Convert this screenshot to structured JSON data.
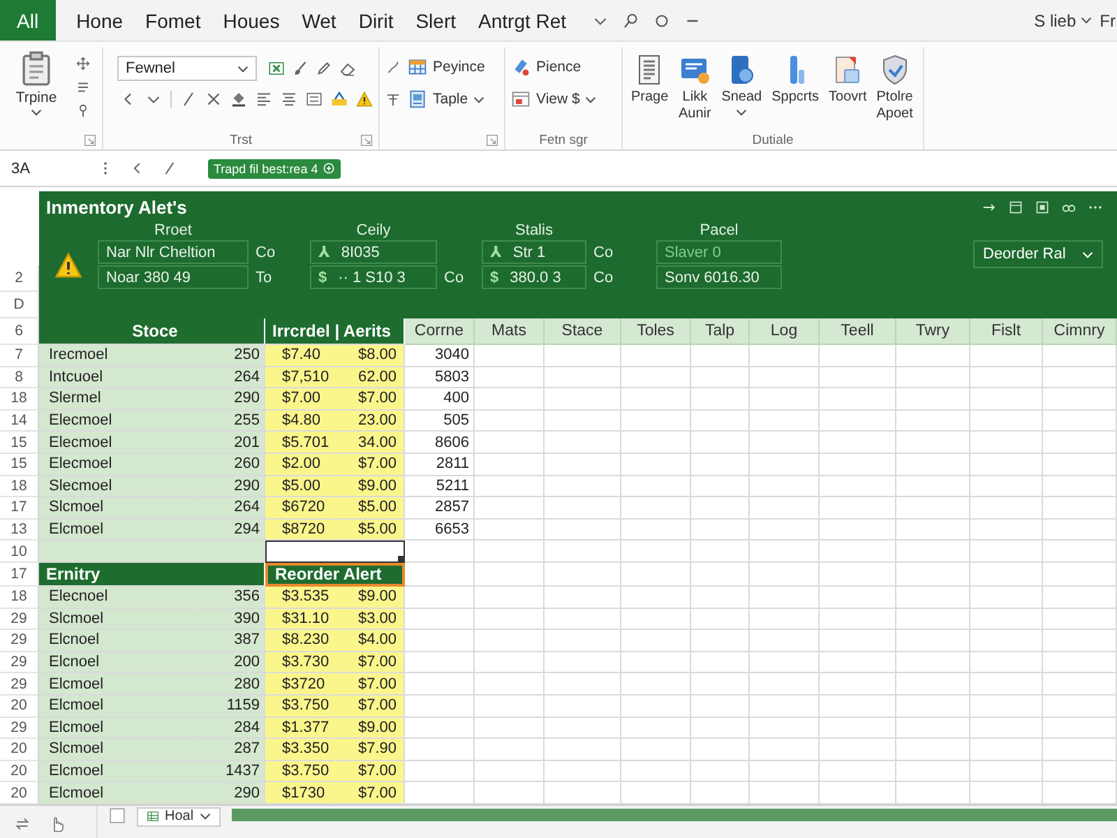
{
  "tabs": [
    {
      "label": "All",
      "selected": true
    },
    {
      "label": "Hone",
      "selected": false
    },
    {
      "label": "Fomet",
      "selected": false
    },
    {
      "label": "Houes",
      "selected": false
    },
    {
      "label": "Wet",
      "selected": false
    },
    {
      "label": "Dirit",
      "selected": false
    },
    {
      "label": "Slert",
      "selected": false
    },
    {
      "label": "Antrgt Ret",
      "selected": false
    }
  ],
  "top_right": {
    "account_label": "S lieb",
    "trailing_text": "Fr"
  },
  "ribbon": {
    "clipboard": {
      "button": {
        "label": "Trpine",
        "dropdown": true
      }
    },
    "font": {
      "font_name": "Fewnel",
      "label": "Trst"
    },
    "table": {
      "buttons": [
        {
          "label": "Peyince",
          "dropdown": false
        },
        {
          "label": "Taple",
          "dropdown": true
        }
      ]
    },
    "format": {
      "buttons": [
        {
          "label": "Pience",
          "dropdown": false
        },
        {
          "label": "View $",
          "dropdown": true
        }
      ],
      "label": "Fetn sgr"
    },
    "details": {
      "buttons": [
        {
          "label": "Prage",
          "dropdown": false
        },
        {
          "label": "Likk Aunir",
          "dropdown": false
        },
        {
          "label": "Snead",
          "dropdown": true
        },
        {
          "label": "Sppcrts",
          "dropdown": false
        },
        {
          "label": "Toovrt",
          "dropdown": false
        },
        {
          "label": "Ptolre Apoet",
          "dropdown": false
        }
      ],
      "label": "Dutiale"
    }
  },
  "formula_bar": {
    "name_box": "3A",
    "chip": "Trapd fil best:rea 4"
  },
  "alert_panel": {
    "row_numbers": [
      "2",
      "D"
    ],
    "title": "Inmentory Alet's",
    "columns": [
      "Rroet",
      "Ceily",
      "Stalis",
      "Pacel"
    ],
    "rows": [
      {
        "fields": [
          {
            "value": "Nar Nlr Cheltion"
          },
          {
            "lead": "Co",
            "prefix": "⅄",
            "value": "8I035"
          },
          {
            "prefix": "⅄",
            "value": "Str 1"
          },
          {
            "lead": "Co",
            "placeholder": "Slaver 0"
          }
        ]
      },
      {
        "fields": [
          {
            "value": "Noar 380 49"
          },
          {
            "lead": "To",
            "prefix": "$",
            "value": "·· 1 S10 3"
          },
          {
            "lead": "Co",
            "prefix": "$",
            "value": "380.0 3"
          },
          {
            "lead": "Co",
            "value": "Sonv 6016.30"
          }
        ]
      }
    ],
    "dropdown": "Deorder Ral"
  },
  "sheet": {
    "rows": [
      {
        "kind": "header",
        "number": "6",
        "groups": [
          {
            "label": "Stoce",
            "highlighted": false
          },
          {
            "label": "Irrcrdel | Aerits",
            "highlighted": false
          }
        ],
        "columns": [
          "Corrne",
          "Mats",
          "Stace",
          "Toles",
          "Talp",
          "Log",
          "Teell",
          "Twry",
          "Fislt",
          "Cimnry"
        ]
      },
      {
        "kind": "data",
        "number": "7",
        "selected": false,
        "cells": [
          "Irecmoel",
          "250",
          "$7.40",
          "$8.00",
          "3040"
        ]
      },
      {
        "kind": "data",
        "number": "8",
        "selected": false,
        "cells": [
          "Intcuoel",
          "264",
          "$7,510",
          "62.00",
          "5803"
        ]
      },
      {
        "kind": "data",
        "number": "18",
        "selected": false,
        "cells": [
          "Slermel",
          "290",
          "$7.00",
          "$7.00",
          "400"
        ]
      },
      {
        "kind": "data",
        "number": "14",
        "selected": false,
        "cells": [
          "Elecmoel",
          "255",
          "$4.80",
          "23.00",
          "505"
        ]
      },
      {
        "kind": "data",
        "number": "15",
        "selected": false,
        "cells": [
          "Elecmoel",
          "201",
          "$5.701",
          "34.00",
          "8606"
        ]
      },
      {
        "kind": "data",
        "number": "15",
        "selected": false,
        "cells": [
          "Elecmoel",
          "260",
          "$2.00",
          "$7.00",
          "2811"
        ]
      },
      {
        "kind": "data",
        "number": "18",
        "selected": false,
        "cells": [
          "Slecmoel",
          "290",
          "$5.00",
          "$9.00",
          "5211"
        ]
      },
      {
        "kind": "data",
        "number": "17",
        "selected": false,
        "cells": [
          "Slcmoel",
          "264",
          "$6720",
          "$5.00",
          "2857"
        ]
      },
      {
        "kind": "data",
        "number": "13",
        "selected": false,
        "cells": [
          "Elcmoel",
          "294",
          "$8720",
          "$5.00",
          "6653"
        ]
      },
      {
        "kind": "blank",
        "number": "10",
        "selected": true
      },
      {
        "kind": "section",
        "number": "17",
        "groups": [
          {
            "label": "Ernitry",
            "highlighted": false
          },
          {
            "label": "Reorder Alert",
            "highlighted": true
          }
        ]
      },
      {
        "kind": "data",
        "number": "18",
        "selected": false,
        "cells": [
          "Elecnoel",
          "356",
          "$3.535",
          "$9.00"
        ]
      },
      {
        "kind": "data",
        "number": "29",
        "selected": false,
        "cells": [
          "Slcmoel",
          "390",
          "$31.10",
          "$3.00"
        ]
      },
      {
        "kind": "data",
        "number": "29",
        "selected": false,
        "cells": [
          "Elcnoel",
          "387",
          "$8.230",
          "$4.00"
        ]
      },
      {
        "kind": "data",
        "number": "29",
        "selected": false,
        "cells": [
          "Elcnoel",
          "200",
          "$3.730",
          "$7.00"
        ]
      },
      {
        "kind": "data",
        "number": "29",
        "selected": false,
        "cells": [
          "Elcmoel",
          "280",
          "$3720",
          "$7.00"
        ]
      },
      {
        "kind": "data",
        "number": "20",
        "selected": false,
        "cells": [
          "Elcmoel",
          "1159",
          "$3.750",
          "$7.00"
        ]
      },
      {
        "kind": "data",
        "number": "29",
        "selected": false,
        "cells": [
          "Elcmoel",
          "284",
          "$1.377",
          "$9.00"
        ]
      },
      {
        "kind": "data",
        "number": "20",
        "selected": false,
        "cells": [
          "Slcmoel",
          "287",
          "$3.350",
          "$7.90"
        ]
      },
      {
        "kind": "data",
        "number": "20",
        "selected": false,
        "cells": [
          "Elcmoel",
          "1437",
          "$3.750",
          "$7.00"
        ]
      },
      {
        "kind": "data",
        "number": "20",
        "selected": false,
        "cells": [
          "Elcmoel",
          "290",
          "$1730",
          "$7.00"
        ]
      }
    ]
  },
  "sheet_tabs": [
    {
      "label": "Hoal",
      "selected": true
    }
  ]
}
